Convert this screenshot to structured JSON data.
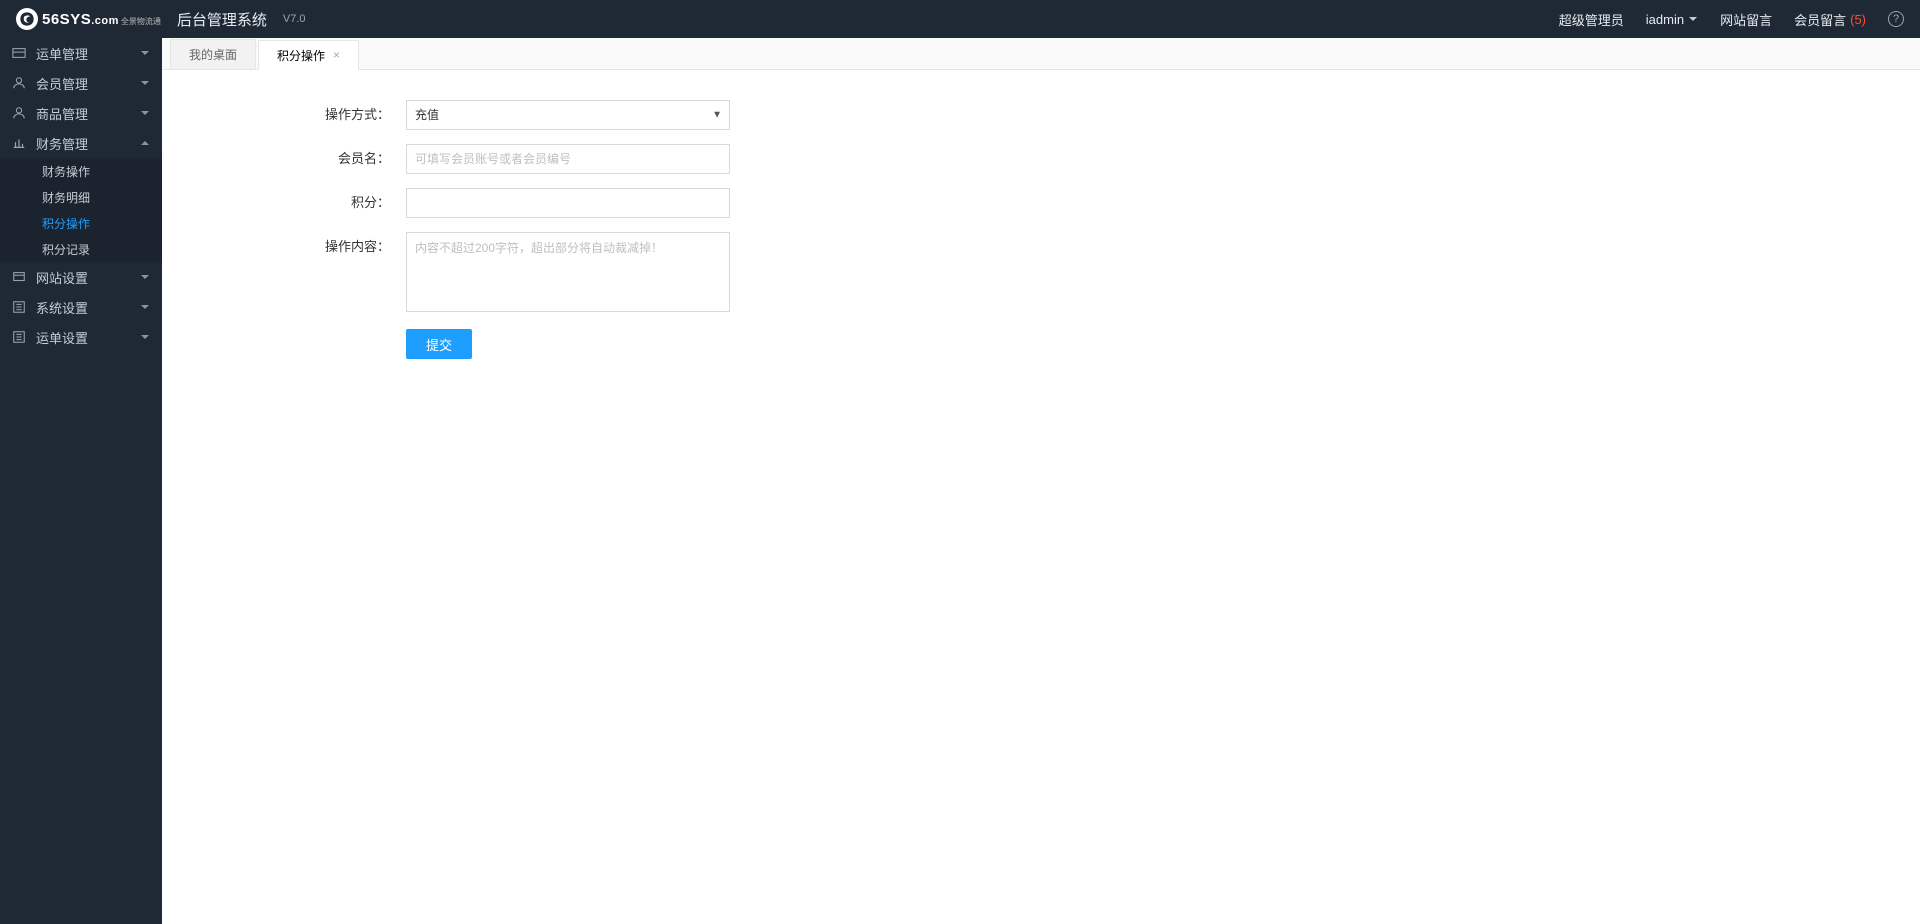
{
  "header": {
    "logo_text": "56SYS",
    "logo_suffix": ".com",
    "logo_tag_top": "全景物流通",
    "system_title": "后台管理系统",
    "version": "V7.0",
    "role": "超级管理员",
    "username": "iadmin",
    "link_site_msg": "网站留言",
    "link_member_msg": "会员留言",
    "member_msg_count": "(5)"
  },
  "sidebar": {
    "items": [
      {
        "label": "运单管理",
        "icon": "waybill"
      },
      {
        "label": "会员管理",
        "icon": "user"
      },
      {
        "label": "商品管理",
        "icon": "user"
      },
      {
        "label": "财务管理",
        "icon": "finance",
        "expanded": true,
        "children": [
          {
            "label": "财务操作"
          },
          {
            "label": "财务明细"
          },
          {
            "label": "积分操作",
            "active": true
          },
          {
            "label": "积分记录"
          }
        ]
      },
      {
        "label": "网站设置",
        "icon": "site"
      },
      {
        "label": "系统设置",
        "icon": "system"
      },
      {
        "label": "运单设置",
        "icon": "system"
      }
    ]
  },
  "tabs": [
    {
      "label": "我的桌面",
      "closable": false,
      "active": false
    },
    {
      "label": "积分操作",
      "closable": true,
      "active": true
    }
  ],
  "form": {
    "labels": {
      "mode": "操作方式：",
      "member": "会员名：",
      "points": "积分：",
      "content": "操作内容："
    },
    "mode_options": [
      "充值"
    ],
    "mode_value": "充值",
    "member_placeholder": "可填写会员账号或者会员编号",
    "content_placeholder": "内容不超过200字符，超出部分将自动裁减掉！",
    "submit": "提交"
  }
}
